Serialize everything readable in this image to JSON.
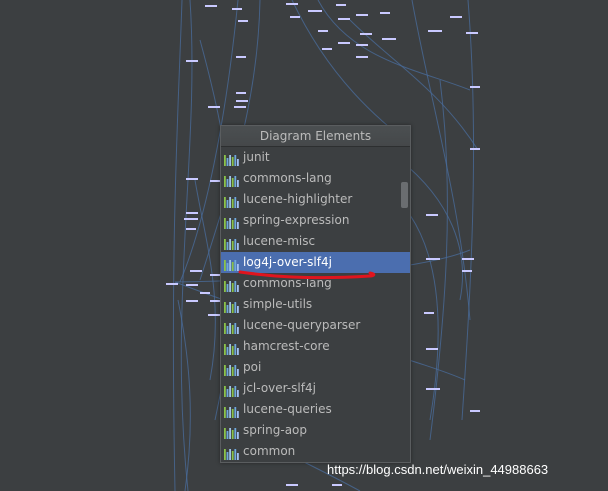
{
  "popup": {
    "title": "Diagram Elements",
    "selected_index": 5,
    "items": [
      {
        "label": "junit"
      },
      {
        "label": "commons-lang"
      },
      {
        "label": "lucene-highlighter"
      },
      {
        "label": "spring-expression"
      },
      {
        "label": "lucene-misc"
      },
      {
        "label": "log4j-over-slf4j"
      },
      {
        "label": "commons-lang"
      },
      {
        "label": "simple-utils"
      },
      {
        "label": "lucene-queryparser"
      },
      {
        "label": "hamcrest-core"
      },
      {
        "label": "poi"
      },
      {
        "label": "jcl-over-slf4j"
      },
      {
        "label": "lucene-queries"
      },
      {
        "label": "spring-aop"
      },
      {
        "label": "common"
      }
    ]
  },
  "watermark": "https://blog.csdn.net/weixin_44988663",
  "colors": {
    "background": "#3c3f41",
    "selection": "#4b6eaf",
    "edge_line": "#4a6e9e",
    "node": "#c9c9ff",
    "annotation": "#e0141e"
  }
}
